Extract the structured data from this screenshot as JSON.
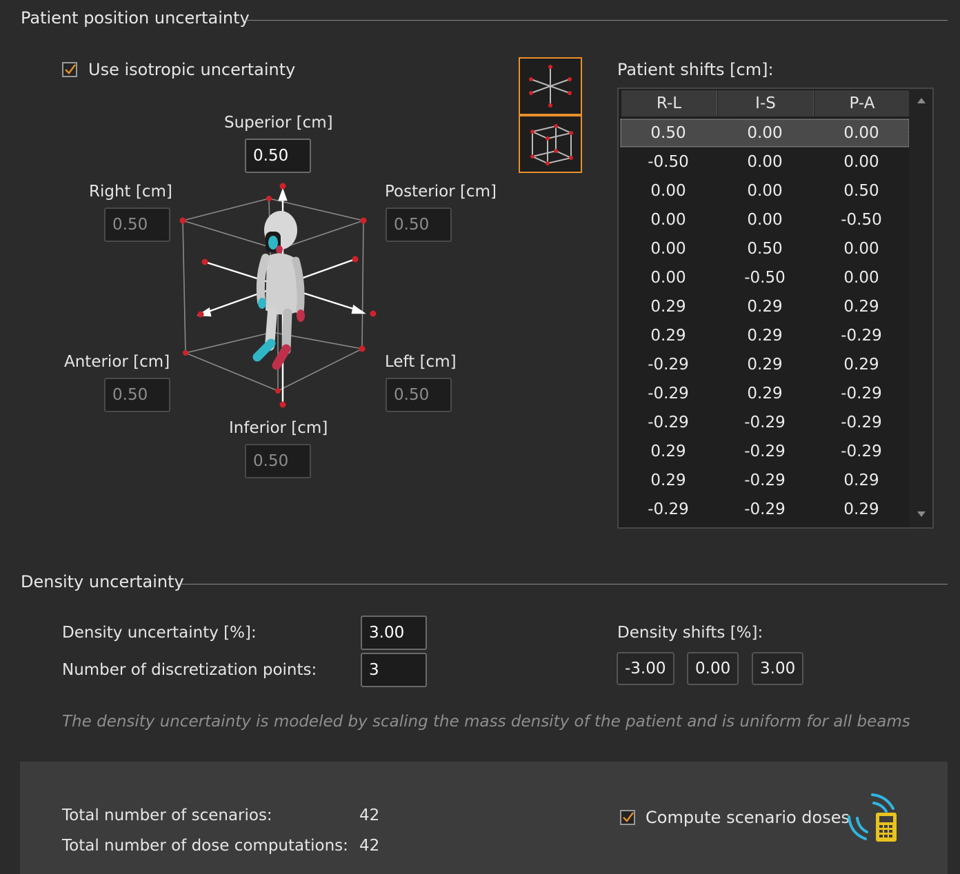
{
  "patient_position": {
    "title": "Patient position uncertainty",
    "isotropic_label": "Use isotropic uncertainty",
    "isotropic_checked": true,
    "fields": {
      "superior": {
        "label": "Superior [cm]",
        "value": "0.50"
      },
      "right": {
        "label": "Right [cm]",
        "value": "0.50"
      },
      "posterior": {
        "label": "Posterior [cm]",
        "value": "0.50"
      },
      "anterior": {
        "label": "Anterior [cm]",
        "value": "0.50"
      },
      "left": {
        "label": "Left [cm]",
        "value": "0.50"
      },
      "inferior": {
        "label": "Inferior [cm]",
        "value": "0.50"
      }
    },
    "shifts_label": "Patient shifts [cm]:",
    "columns": [
      "R-L",
      "I-S",
      "P-A"
    ],
    "rows": [
      [
        "0.50",
        "0.00",
        "0.00"
      ],
      [
        "-0.50",
        "0.00",
        "0.00"
      ],
      [
        "0.00",
        "0.00",
        "0.50"
      ],
      [
        "0.00",
        "0.00",
        "-0.50"
      ],
      [
        "0.00",
        "0.50",
        "0.00"
      ],
      [
        "0.00",
        "-0.50",
        "0.00"
      ],
      [
        "0.29",
        "0.29",
        "0.29"
      ],
      [
        "0.29",
        "0.29",
        "-0.29"
      ],
      [
        "-0.29",
        "0.29",
        "0.29"
      ],
      [
        "-0.29",
        "0.29",
        "-0.29"
      ],
      [
        "-0.29",
        "-0.29",
        "-0.29"
      ],
      [
        "0.29",
        "-0.29",
        "-0.29"
      ],
      [
        "0.29",
        "-0.29",
        "0.29"
      ],
      [
        "-0.29",
        "-0.29",
        "0.29"
      ]
    ],
    "mode_icons": [
      "star-axes-icon",
      "cube-corners-icon"
    ]
  },
  "density": {
    "title": "Density uncertainty",
    "uncertainty_label": "Density uncertainty [%]:",
    "uncertainty_value": "3.00",
    "points_label": "Number of discretization points:",
    "points_value": "3",
    "shifts_label": "Density shifts [%]:",
    "shifts": [
      "-3.00",
      "0.00",
      "3.00"
    ],
    "note": "The density uncertainty is modeled by scaling the mass density of the patient and is uniform for all beams"
  },
  "summary": {
    "scenarios_label": "Total number of scenarios:",
    "scenarios_value": "42",
    "dose_label": "Total number of dose computations:",
    "dose_value": "42",
    "compute_label": "Compute scenario doses",
    "compute_checked": true,
    "compute_icon": "calculator-wireless-icon"
  },
  "colors": {
    "accent": "#e8902b",
    "marker": "#d0222a",
    "background": "#2b2b2b"
  }
}
